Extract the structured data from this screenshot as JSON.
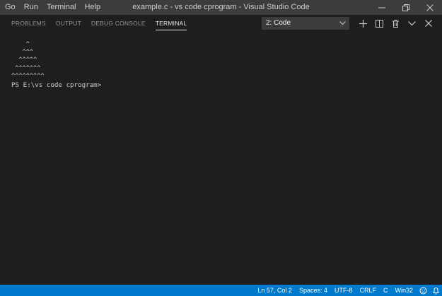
{
  "menubar": {
    "items": [
      "Go",
      "Run",
      "Terminal",
      "Help"
    ]
  },
  "window": {
    "title": "example.c - vs code cprogram - Visual Studio Code"
  },
  "panel": {
    "tabs": [
      {
        "label": "PROBLEMS",
        "active": false
      },
      {
        "label": "OUTPUT",
        "active": false
      },
      {
        "label": "DEBUG CONSOLE",
        "active": false
      },
      {
        "label": "TERMINAL",
        "active": true
      }
    ],
    "terminal_select": {
      "value": "2: Code"
    },
    "actions": [
      "plus-icon",
      "split-icon",
      "trash-icon",
      "chevron-down-icon",
      "close-icon"
    ]
  },
  "terminal": {
    "lines": [
      "    ^",
      "   ^^^",
      "  ^^^^^",
      " ^^^^^^^",
      "^^^^^^^^^"
    ],
    "prompt": "PS E:\\vs code cprogram> "
  },
  "statusbar": {
    "position": "Ln 57, Col 2",
    "spaces": "Spaces: 4",
    "encoding": "UTF-8",
    "eol": "CRLF",
    "language": "C",
    "platform": "Win32"
  },
  "colors": {
    "titlebar": "#3c3c3c",
    "background": "#1e1e1e",
    "statusbar": "#007acc",
    "text": "#cccccc"
  }
}
